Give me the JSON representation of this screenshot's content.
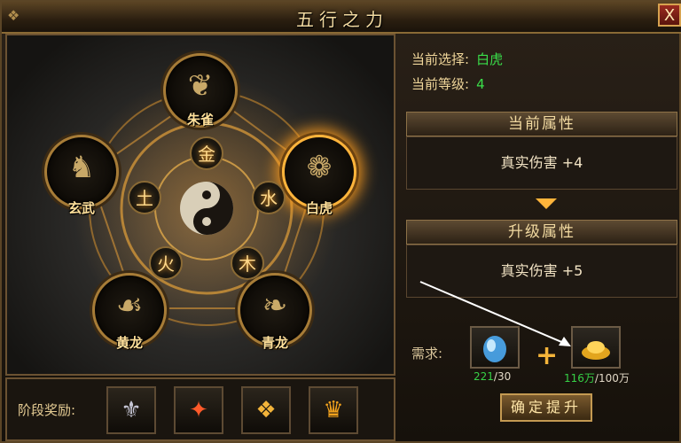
{
  "window": {
    "title": "五行之力",
    "close_label": "X"
  },
  "nodes": [
    {
      "name": "朱雀",
      "glyph": "❦",
      "selected": false
    },
    {
      "name": "玄武",
      "glyph": "♞",
      "selected": false
    },
    {
      "name": "白虎",
      "glyph": "❁",
      "selected": true
    },
    {
      "name": "黄龙",
      "glyph": "☙",
      "selected": false
    },
    {
      "name": "青龙",
      "glyph": "❧",
      "selected": false
    }
  ],
  "elements": [
    "金",
    "水",
    "木",
    "火",
    "土"
  ],
  "center_icon": "yin-yang-icon",
  "selection": {
    "current_label": "当前选择:",
    "current_value": "白虎",
    "level_label": "当前等级:",
    "level_value": "4"
  },
  "current_attr": {
    "header": "当前属性",
    "text": "真实伤害 +4"
  },
  "upgrade_attr": {
    "header": "升级属性",
    "text": "真实伤害 +5"
  },
  "requirements": {
    "label": "需求:",
    "items": [
      {
        "icon": "blue-crystal-icon",
        "have": "221",
        "need": "/30"
      },
      {
        "icon": "gold-ingot-icon",
        "have": "116万",
        "need": "/100万"
      }
    ],
    "plus": "+"
  },
  "confirm_label": "确定提升",
  "stage_rewards": {
    "label": "阶段奖励:",
    "items": [
      {
        "icon": "silver-helmet-icon",
        "glyph": "⚜",
        "color": "#c7c7d6"
      },
      {
        "icon": "ruby-emblem-icon",
        "glyph": "✦",
        "color": "#ff5a2a"
      },
      {
        "icon": "gold-emblem-icon",
        "glyph": "❖",
        "color": "#f3b43a"
      },
      {
        "icon": "crown-crest-icon",
        "glyph": "♛",
        "color": "#f2a21d"
      }
    ]
  },
  "colors": {
    "accent_orange": "#ff9e1f",
    "value_green": "#3adf4a"
  }
}
